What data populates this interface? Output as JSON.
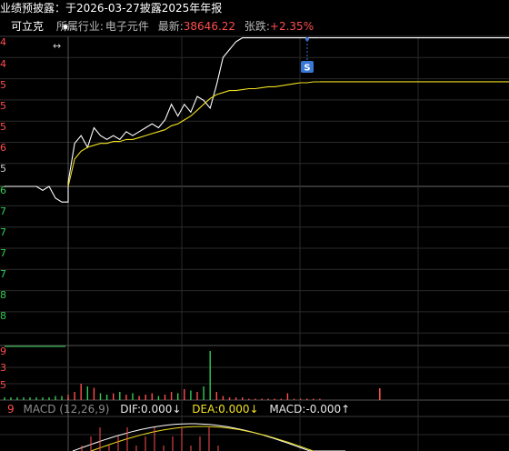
{
  "notice": {
    "text": "业绩预披露：于2026-03-27披露2025年年报"
  },
  "header": {
    "stock_name": "可立克",
    "industry_label": "所属行业:",
    "industry_value": "电子元件",
    "latest_label": "最新:",
    "latest_value": "38646.22",
    "change_label": "张跌:",
    "change_value": "+2.35%"
  },
  "left_axis_labels": [
    "4",
    "4",
    "5",
    "5",
    "5",
    "6",
    "5",
    "6",
    "7",
    "7",
    "7",
    "7",
    "8",
    "8"
  ],
  "volume_axis_labels": [
    "9",
    "3",
    "5"
  ],
  "macd_axis_label": "9",
  "marker": {
    "label": "S"
  },
  "macd": {
    "title": "MACD (12,26,9)",
    "dif_label": "DIF:",
    "dif_value": "0.000↓",
    "dea_label": "DEA:",
    "dea_value": "0.000↓",
    "macd_label": "MACD:",
    "macd_value": "-0.000↑"
  },
  "colors": {
    "price_line": "#ffffff",
    "avg_line": "#f0e020",
    "up": "#ff4d4d",
    "down": "#33cc55",
    "grid": "#2a2a2a",
    "marker": "#3a78d8"
  },
  "chart_data": {
    "type": "line",
    "series": [
      {
        "values": [
          0,
          0,
          0,
          0,
          0,
          0,
          -0.2,
          0,
          -0.6,
          -0.8,
          -0.8,
          0.2,
          2.2,
          2.6,
          2.0,
          3.0,
          2.6,
          2.4,
          2.6,
          2.4,
          2.8,
          2.6,
          2.8,
          3.0,
          3.2,
          3.0,
          3.4,
          4.2,
          3.6,
          4.2,
          3.8,
          4.6,
          4.4,
          4.0,
          5.2,
          6.6,
          7.0,
          7.4,
          7.6,
          7.6,
          7.6,
          7.6,
          7.6,
          7.6,
          7.6,
          7.6,
          7.6,
          7.6,
          7.6,
          7.6,
          7.6
        ]
      },
      {
        "values": [
          0,
          0,
          0,
          0,
          0,
          0,
          0,
          0,
          0,
          0,
          0,
          0,
          1.4,
          1.8,
          2.0,
          2.1,
          2.2,
          2.2,
          2.3,
          2.3,
          2.4,
          2.4,
          2.5,
          2.6,
          2.7,
          2.8,
          2.9,
          3.1,
          3.2,
          3.4,
          3.6,
          3.9,
          4.2,
          4.5,
          4.7,
          4.8,
          4.9,
          4.9,
          4.95,
          5.0,
          5.0,
          5.05,
          5.1,
          5.1,
          5.15,
          5.2,
          5.25,
          5.3,
          5.3,
          5.35,
          5.35
        ]
      }
    ],
    "volume": [
      0.2,
      0.2,
      0.2,
      0.2,
      0.2,
      0.2,
      0.2,
      0.2,
      0.3,
      0.3,
      0.2,
      0.4,
      0.6,
      1.2,
      1.0,
      0.9,
      0.5,
      0.4,
      0.5,
      0.6,
      0.4,
      0.5,
      0.3,
      0.4,
      0.5,
      0.3,
      0.4,
      0.6,
      0.5,
      0.8,
      0.7,
      0.6,
      1.0,
      3.6,
      0.6,
      0.3,
      0.2,
      0.2,
      0.2,
      0.1,
      0.1,
      0.1,
      0.1,
      0.1,
      0.1,
      0.5,
      0.1,
      0.1,
      0.1,
      0.1,
      0.1
    ]
  }
}
